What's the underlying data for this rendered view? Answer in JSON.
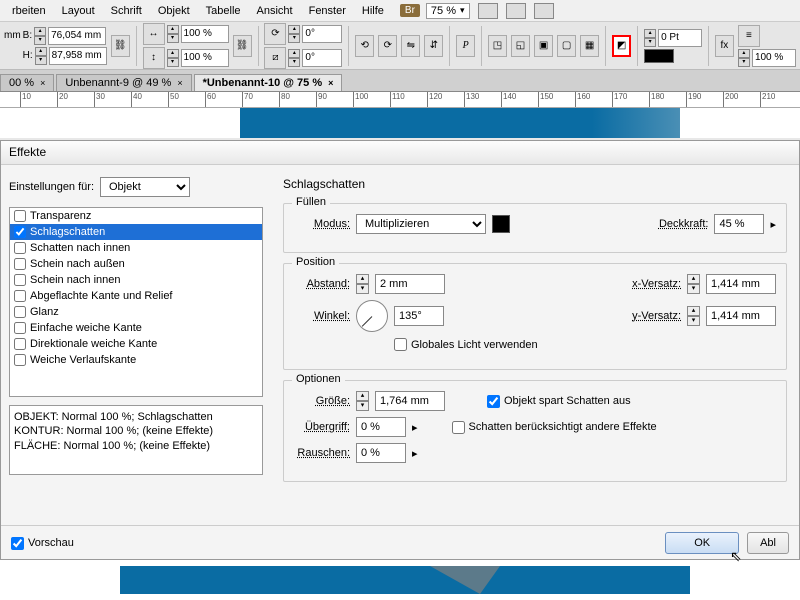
{
  "menu": {
    "items": [
      "rbeiten",
      "Layout",
      "Schrift",
      "Objekt",
      "Tabelle",
      "Ansicht",
      "Fenster",
      "Hilfe"
    ],
    "br_badge": "Br",
    "zoom": "75 %"
  },
  "control": {
    "unit_suffix": "mm",
    "B": "76,054 mm",
    "H": "87,958 mm",
    "scale_x": "100 %",
    "scale_y": "100 %",
    "rotate": "0°",
    "shear": "0°",
    "stroke_pt": "0 Pt",
    "stroke_pct": "100 %"
  },
  "tabs": [
    {
      "label": "00 %",
      "active": false
    },
    {
      "label": "Unbenannt-9 @ 49 %",
      "active": false
    },
    {
      "label": "*Unbenannt-10 @ 75 %",
      "active": true
    }
  ],
  "ruler_ticks": [
    10,
    20,
    30,
    40,
    50,
    60,
    70,
    80,
    90,
    100,
    110,
    120,
    130,
    140,
    150,
    160,
    170,
    180,
    190,
    200,
    210
  ],
  "dialog": {
    "title": "Effekte",
    "settings_for_label": "Einstellungen für:",
    "settings_for_value": "Objekt",
    "effects": [
      {
        "label": "Transparenz",
        "checked": false,
        "selected": false
      },
      {
        "label": "Schlagschatten",
        "checked": true,
        "selected": true
      },
      {
        "label": "Schatten nach innen",
        "checked": false,
        "selected": false
      },
      {
        "label": "Schein nach außen",
        "checked": false,
        "selected": false
      },
      {
        "label": "Schein nach innen",
        "checked": false,
        "selected": false
      },
      {
        "label": "Abgeflachte Kante und Relief",
        "checked": false,
        "selected": false
      },
      {
        "label": "Glanz",
        "checked": false,
        "selected": false
      },
      {
        "label": "Einfache weiche Kante",
        "checked": false,
        "selected": false
      },
      {
        "label": "Direktionale weiche Kante",
        "checked": false,
        "selected": false
      },
      {
        "label": "Weiche Verlaufskante",
        "checked": false,
        "selected": false
      }
    ],
    "summary": [
      "OBJEKT: Normal 100 %; Schlagschatten",
      "KONTUR: Normal 100 %; (keine Effekte)",
      "FLÄCHE: Normal 100 %; (keine Effekte)"
    ],
    "panel_title": "Schlagschatten",
    "fill": {
      "legend": "Füllen",
      "mode_label": "Modus:",
      "mode_value": "Multiplizieren",
      "opacity_label": "Deckkraft:",
      "opacity_value": "45 %"
    },
    "position": {
      "legend": "Position",
      "distance_label": "Abstand:",
      "distance_value": "2 mm",
      "angle_label": "Winkel:",
      "angle_value": "135°",
      "x_label": "x-Versatz:",
      "x_value": "1,414 mm",
      "y_label": "y-Versatz:",
      "y_value": "1,414 mm",
      "global_light": "Globales Licht verwenden",
      "global_light_checked": false
    },
    "options": {
      "legend": "Optionen",
      "size_label": "Größe:",
      "size_value": "1,764 mm",
      "spread_label": "Übergriff:",
      "spread_value": "0 %",
      "noise_label": "Rauschen:",
      "noise_value": "0 %",
      "knock_label": "Objekt spart Schatten aus",
      "knock_checked": true,
      "honor_label": "Schatten berücksichtigt andere Effekte",
      "honor_checked": false
    },
    "preview_label": "Vorschau",
    "preview_checked": true,
    "ok": "OK",
    "cancel": "Abl"
  }
}
